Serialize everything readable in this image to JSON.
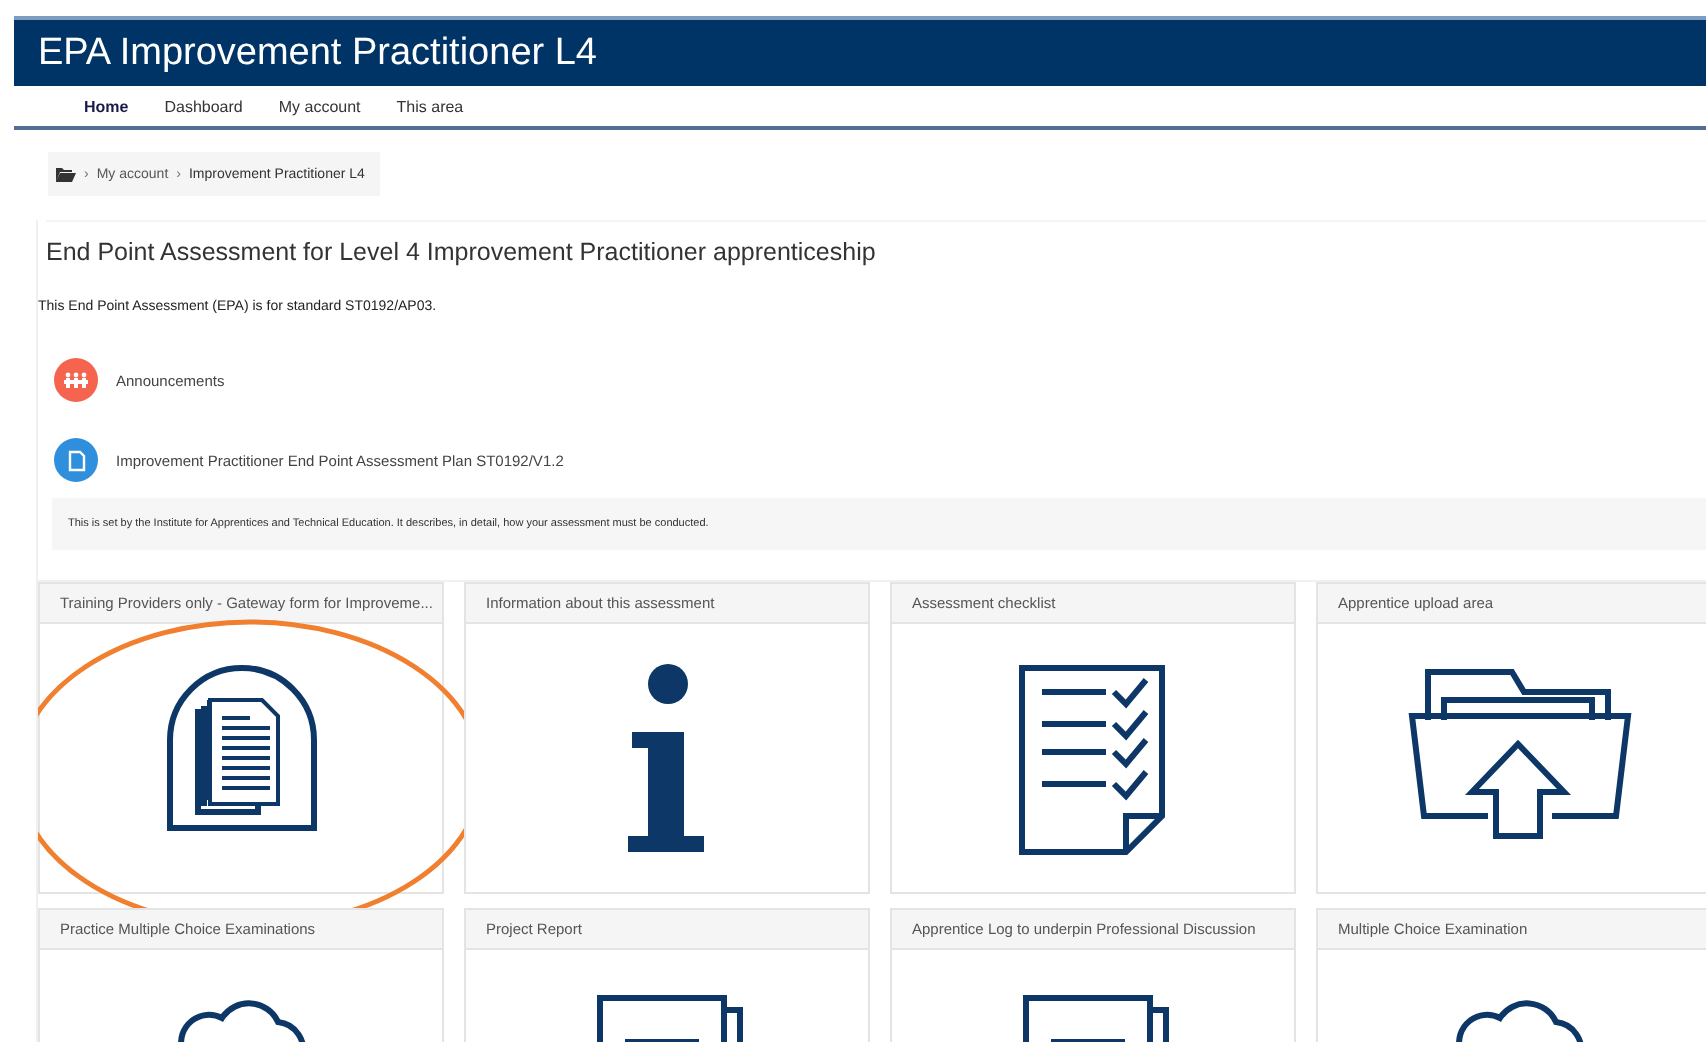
{
  "site": {
    "title": "EPA Improvement Practitioner L4"
  },
  "nav": [
    {
      "label": "Home",
      "selected": true
    },
    {
      "label": "Dashboard",
      "selected": false
    },
    {
      "label": "My account",
      "selected": false
    },
    {
      "label": "This area",
      "selected": false
    }
  ],
  "breadcrumb": [
    {
      "separator": "›",
      "label": "My account",
      "kind": "link"
    },
    {
      "separator": "›",
      "label": "Improvement Practitioner L4",
      "kind": "current"
    }
  ],
  "heading": "End Point Assessment for Level 4 Improvement Practitioner apprenticeship",
  "intro": "This End Point Assessment (EPA) is for standard ST0192/AP03.",
  "activities": [
    {
      "kind": "forum",
      "label": "Announcements",
      "color": "#f4644f"
    },
    {
      "kind": "file",
      "label": "Improvement Practitioner End Point Assessment Plan ST0192/V1.2",
      "color": "#2f8fdd"
    }
  ],
  "note": "This is set by the Institute for Apprentices and Technical Education.  It describes, in detail, how your assessment must be conducted.",
  "tiles": [
    {
      "title": "Training Providers only - Gateway form for Improveme...",
      "kind": "documents",
      "circled": true
    },
    {
      "title": "Information about this assessment",
      "kind": "info",
      "circled": false
    },
    {
      "title": "Assessment checklist",
      "kind": "checklist",
      "circled": false
    },
    {
      "title": "Apprentice upload area",
      "kind": "upload",
      "circled": false
    },
    {
      "title": "Practice Multiple Choice Examinations",
      "kind": "quiz",
      "circled": false
    },
    {
      "title": "Project Report",
      "kind": "report",
      "circled": false
    },
    {
      "title": "Apprentice Log to underpin Professional Discussion",
      "kind": "report",
      "circled": false
    },
    {
      "title": "Multiple Choice Examination",
      "kind": "quiz",
      "circled": false
    }
  ]
}
